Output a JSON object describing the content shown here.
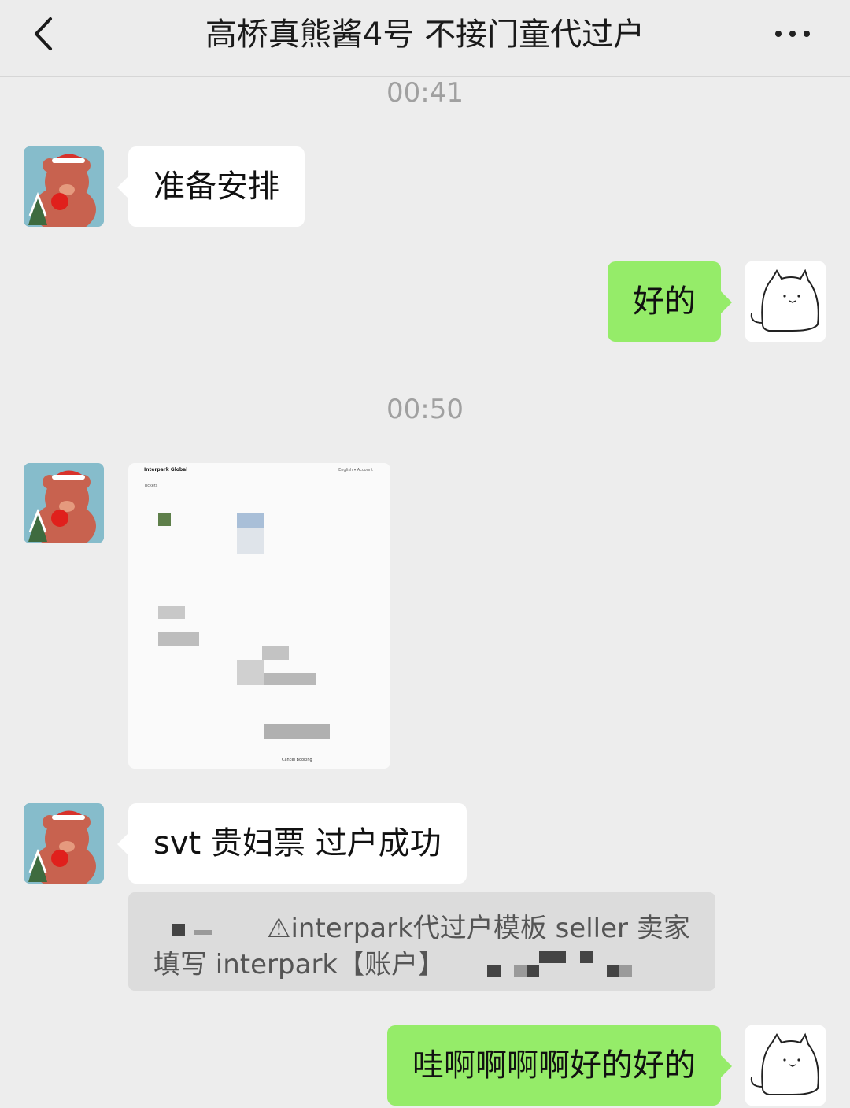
{
  "header": {
    "title": "高桥真熊酱4号 不接门童代过户",
    "back_icon": "chevron-left-icon",
    "more_icon": "more-dots-icon"
  },
  "messages": {
    "time1": "00:41",
    "msg1": "准备安排",
    "msg2": "好的",
    "time2": "00:50",
    "image": {
      "brand": "Interpark Global",
      "top_right": "English ▾   Account",
      "tab": "Tickets",
      "footer": "Cancel Booking"
    },
    "msg3": "svt 贵妇票 过户成功",
    "quote": {
      "line1": "⚠interpark代过户模板 seller 卖家",
      "line2": "填写 interpark【账户】"
    },
    "msg4": "哇啊啊啊啊好的好的"
  },
  "colors": {
    "sent_bubble": "#95ec69",
    "received_bubble": "#ffffff",
    "background": "#ededed"
  }
}
